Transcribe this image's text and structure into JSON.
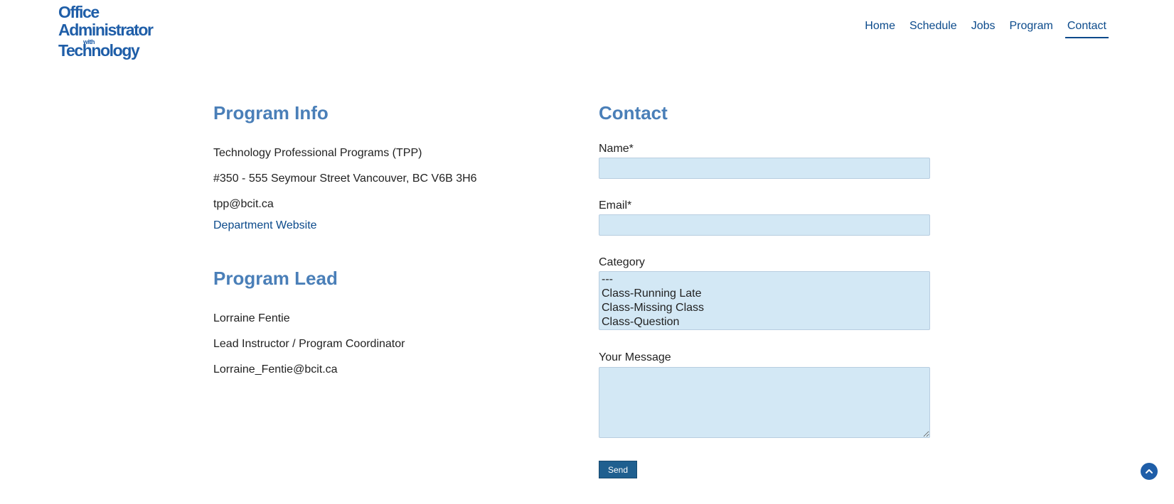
{
  "logo": {
    "line1": "Office",
    "line2": "Administrator",
    "line3": "with",
    "line4": "Technology"
  },
  "nav": {
    "items": [
      {
        "label": "Home"
      },
      {
        "label": "Schedule"
      },
      {
        "label": "Jobs"
      },
      {
        "label": "Program"
      },
      {
        "label": "Contact",
        "active": true
      }
    ]
  },
  "program_info": {
    "title": "Program Info",
    "org": "Technology Professional Programs (TPP)",
    "address": "#350 - 555 Seymour Street Vancouver, BC V6B 3H6",
    "email": "tpp@bcit.ca",
    "website_link": "Department Website"
  },
  "program_lead": {
    "title": "Program Lead",
    "name": "Lorraine Fentie",
    "role": "Lead Instructor / Program Coordinator",
    "email": "Lorraine_Fentie@bcit.ca"
  },
  "contact_form": {
    "title": "Contact",
    "name_label": "Name*",
    "name_value": "",
    "email_label": "Email*",
    "email_value": "",
    "category_label": "Category",
    "category_options": [
      "---",
      "Class-Running Late",
      "Class-Missing Class",
      "Class-Question"
    ],
    "message_label": "Your Message",
    "message_value": "",
    "send_label": "Send"
  },
  "colors": {
    "accent": "#4a7fb8",
    "link": "#0b4a8b",
    "field_bg": "#d3e8f5",
    "button_bg": "#1f5f8f"
  },
  "icons": {
    "scroll_top": "chevron-up-icon"
  }
}
